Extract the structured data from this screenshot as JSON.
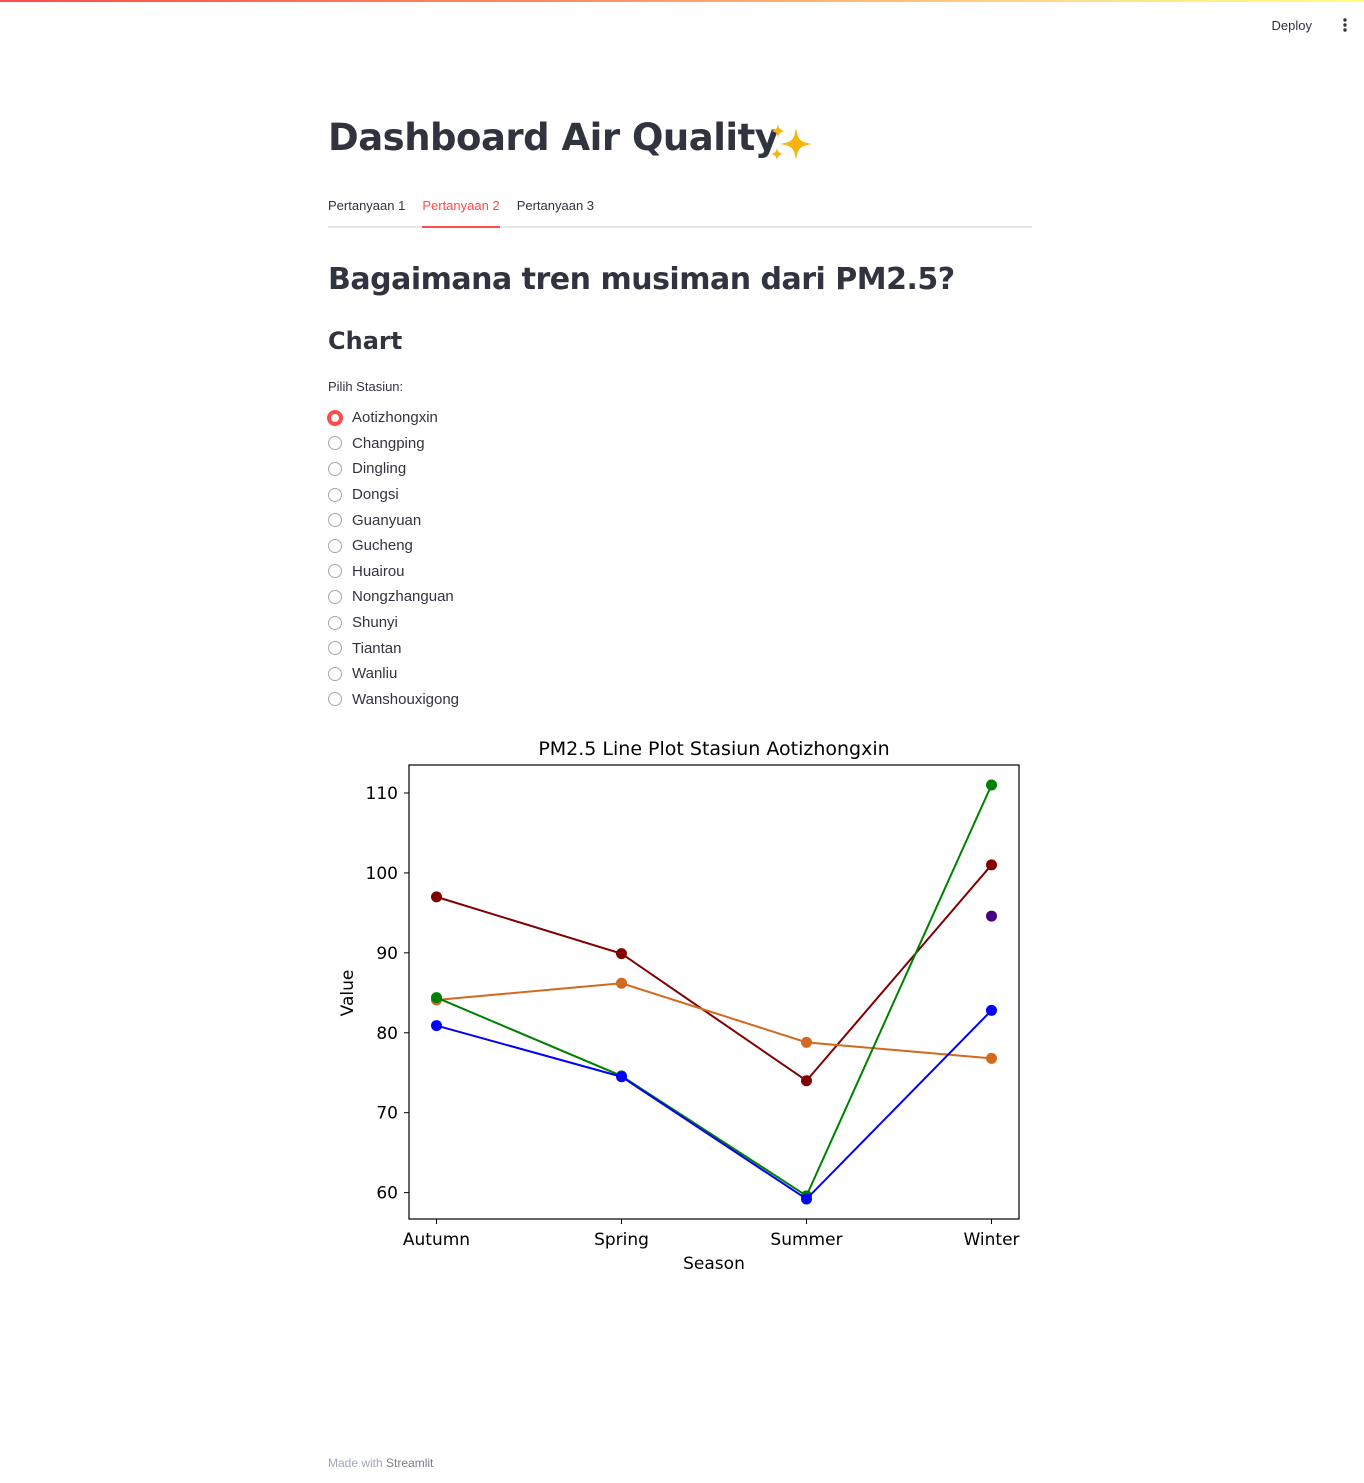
{
  "header": {
    "deploy_label": "Deploy",
    "menu_icon": "kebab-vertical-icon"
  },
  "page": {
    "title": "Dashboard Air Quality",
    "title_icon": "sparkles-icon"
  },
  "tabs": [
    {
      "label": "Pertanyaan 1",
      "active": false
    },
    {
      "label": "Pertanyaan 2",
      "active": true
    },
    {
      "label": "Pertanyaan 3",
      "active": false
    }
  ],
  "content": {
    "heading": "Bagaimana tren musiman dari PM2.5?",
    "subheading": "Chart",
    "radio_label": "Pilih Stasiun:",
    "stations": [
      "Aotizhongxin",
      "Changping",
      "Dingling",
      "Dongsi",
      "Guanyuan",
      "Gucheng",
      "Huairou",
      "Nongzhanguan",
      "Shunyi",
      "Tiantan",
      "Wanliu",
      "Wanshouxigong"
    ],
    "selected_station": "Aotizhongxin"
  },
  "colors": {
    "accent": "#ff4b4b",
    "text": "#31333f",
    "muted": "#a3a8b8"
  },
  "chart_data": {
    "type": "line",
    "title": "PM2.5 Line Plot Stasiun Aotizhongxin",
    "xlabel": "Season",
    "ylabel": "Value",
    "categories": [
      "Autumn",
      "Spring",
      "Summer",
      "Winter"
    ],
    "ylim": [
      56.7,
      113.5
    ],
    "yticks": [
      60,
      70,
      80,
      90,
      100,
      110
    ],
    "grid": false,
    "series": [
      {
        "color": "#800000",
        "values": [
          97.0,
          89.9,
          74.0,
          101.0
        ]
      },
      {
        "color": "#d2691e",
        "values": [
          84.1,
          86.2,
          78.8,
          76.8
        ]
      },
      {
        "color": "#008000",
        "values": [
          84.4,
          74.6,
          59.6,
          111.0
        ]
      },
      {
        "color": "#0000ff",
        "values": [
          80.9,
          74.5,
          59.2,
          82.8
        ]
      },
      {
        "color": "#4b0082",
        "values": [
          null,
          null,
          null,
          94.6
        ]
      }
    ]
  },
  "footer": {
    "prefix": "Made with",
    "brand": "Streamlit"
  }
}
